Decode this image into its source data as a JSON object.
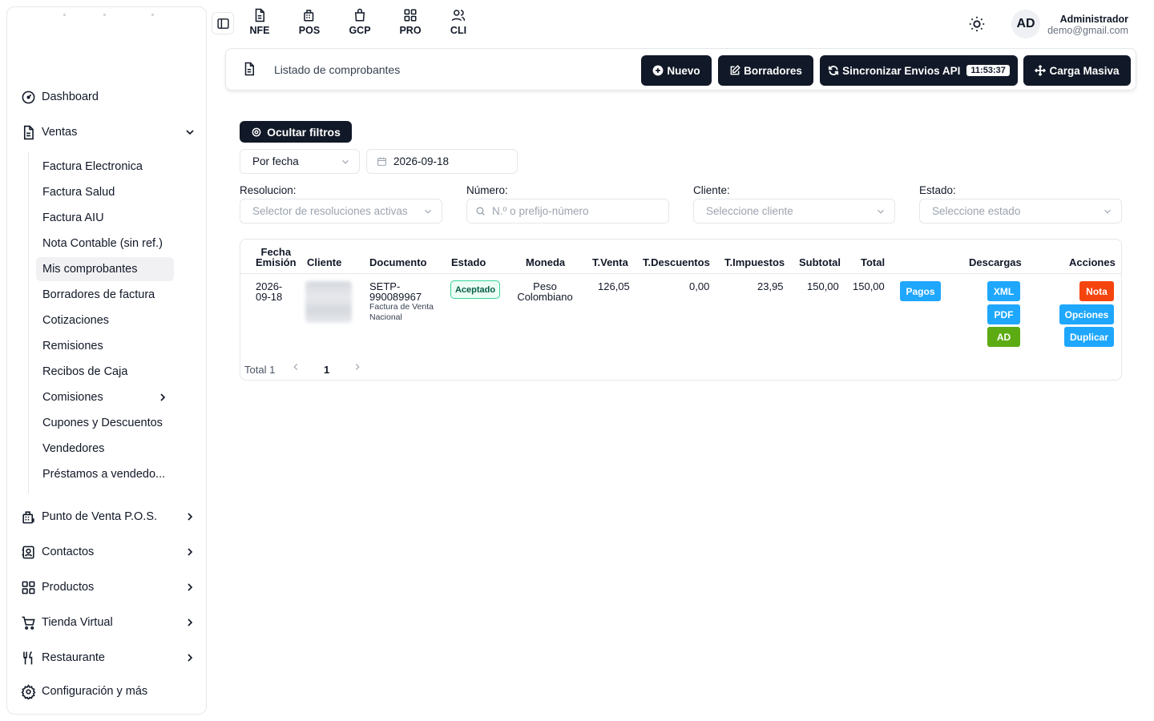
{
  "sidebar": {
    "items": [
      {
        "label": "Dashboard",
        "icon": "gauge-icon"
      },
      {
        "label": "Ventas",
        "icon": "document-icon"
      },
      {
        "label": "Punto de Venta P.O.S.",
        "icon": "pos-icon"
      },
      {
        "label": "Contactos",
        "icon": "contacts-icon"
      },
      {
        "label": "Productos",
        "icon": "grid-icon"
      },
      {
        "label": "Tienda Virtual",
        "icon": "cart-icon"
      },
      {
        "label": "Restaurante",
        "icon": "utensils-icon"
      },
      {
        "label": "Configuración y más",
        "icon": "gear-icon"
      }
    ],
    "ventas_sub": [
      "Factura Electronica",
      "Factura Salud",
      "Factura AIU",
      "Nota Contable (sin ref.)",
      "Mis comprobantes",
      "Borradores de factura",
      "Cotizaciones",
      "Remisiones",
      "Recibos de Caja",
      "Comisiones",
      "Cupones y Descuentos",
      "Vendedores",
      "Préstamos a vendedo..."
    ]
  },
  "topbar": {
    "modules": [
      "NFE",
      "POS",
      "GCP",
      "PRO",
      "CLI"
    ],
    "user": {
      "initials": "AD",
      "name": "Administrador",
      "email": "demo@gmail.com"
    }
  },
  "header": {
    "title": "Listado de comprobantes",
    "buttons": {
      "nuevo": "Nuevo",
      "borradores": "Borradores",
      "sincronizar": "Sincronizar Envios API",
      "time": "11:53:37",
      "carga": "Carga Masiva"
    }
  },
  "filters": {
    "toggle_label": "Ocultar filtros",
    "date_mode": "Por fecha",
    "date_value": "2026-09-18",
    "resolucion_label": "Resolucion:",
    "resolucion_placeholder": "Selector de resoluciones activas",
    "numero_label": "Número:",
    "numero_placeholder": "N.º o prefijo-número",
    "cliente_label": "Cliente:",
    "cliente_placeholder": "Seleccione cliente",
    "estado_label": "Estado:",
    "estado_placeholder": "Seleccione estado"
  },
  "table": {
    "headers": {
      "fecha_1": "Fecha",
      "fecha_2": "Emisión",
      "cliente": "Cliente",
      "documento": "Documento",
      "estado": "Estado",
      "moneda": "Moneda",
      "tventa": "T.Venta",
      "tdesc": "T.Descuentos",
      "timp": "T.Impuestos",
      "subtotal": "Subtotal",
      "total": "Total",
      "descargas": "Descargas",
      "acciones": "Acciones"
    },
    "row": {
      "fecha_1": "2026-",
      "fecha_2": "09-18",
      "doc_1": "SETP-",
      "doc_2": "990089967",
      "doc_sub_1": "Factura de Venta",
      "doc_sub_2": "Nacional",
      "estado": "Aceptado",
      "moneda_1": "Peso",
      "moneda_2": "Colombiano",
      "tventa": "126,05",
      "tdesc": "0,00",
      "timp": "23,95",
      "subtotal": "150,00",
      "total": "150,00",
      "pagos": "Pagos",
      "xml": "XML",
      "pdf": "PDF",
      "ad": "AD",
      "nota": "Nota",
      "opciones": "Opciones",
      "duplicar": "Duplicar"
    },
    "footer": {
      "total": "Total 1",
      "page": "1"
    }
  }
}
